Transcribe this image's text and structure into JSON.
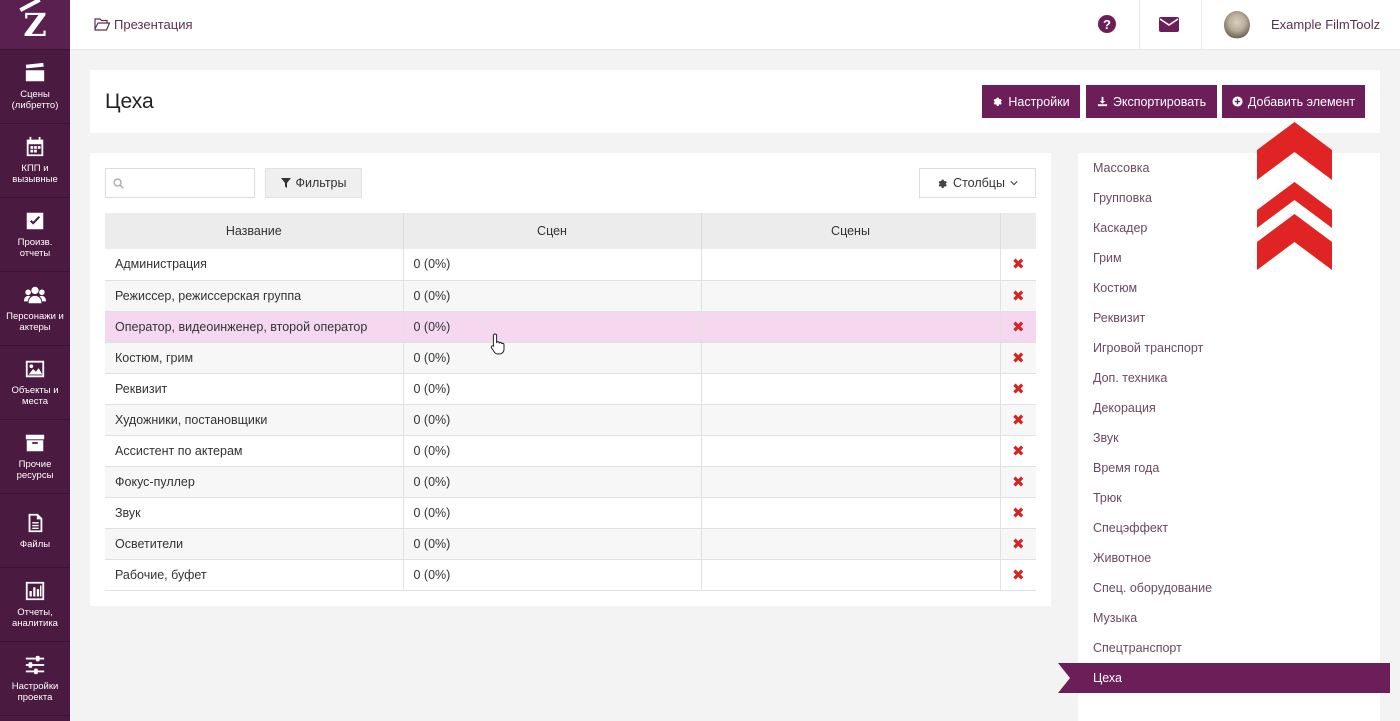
{
  "sidebar": {
    "logo": "Z",
    "items": [
      {
        "label": "Сцены\n(либретто)",
        "icon": "clapperboard-icon"
      },
      {
        "label": "КПП и\nвызывные",
        "icon": "calendar-icon"
      },
      {
        "label": "Произв.\nотчеты",
        "icon": "checkbox-icon"
      },
      {
        "label": "Персонажи и\nактеры",
        "icon": "users-icon"
      },
      {
        "label": "Объекты и\nместа",
        "icon": "image-icon"
      },
      {
        "label": "Прочие\nресурсы",
        "icon": "archive-icon"
      },
      {
        "label": "Файлы",
        "icon": "file-icon"
      },
      {
        "label": "Отчеты,\nаналитика",
        "icon": "bar-chart-icon"
      },
      {
        "label": "Настройки\nпроекта",
        "icon": "sliders-icon"
      }
    ]
  },
  "topbar": {
    "breadcrumb": "Презентация",
    "help": "?",
    "user_name": "Example FilmToolz"
  },
  "header": {
    "title": "Цеха",
    "settings_label": "Настройки",
    "export_label": "Экспортировать",
    "add_label": "Добавить элемент"
  },
  "toolbar": {
    "search_placeholder": "",
    "filter_label": "Фильтры",
    "columns_label": "Столбцы"
  },
  "table": {
    "columns": [
      "Название",
      "Сцен",
      "Сцены"
    ],
    "rows": [
      {
        "name": "Администрация",
        "count": "0 (0%)",
        "scenes": ""
      },
      {
        "name": "Режиссер, режиссерская группа",
        "count": "0 (0%)",
        "scenes": ""
      },
      {
        "name": "Оператор, видеоинженер, второй оператор",
        "count": "0 (0%)",
        "scenes": ""
      },
      {
        "name": "Костюм, грим",
        "count": "0 (0%)",
        "scenes": ""
      },
      {
        "name": "Реквизит",
        "count": "0 (0%)",
        "scenes": ""
      },
      {
        "name": "Художники, постановщики",
        "count": "0 (0%)",
        "scenes": ""
      },
      {
        "name": "Ассистент по актерам",
        "count": "0 (0%)",
        "scenes": ""
      },
      {
        "name": "Фокус-пуллер",
        "count": "0 (0%)",
        "scenes": ""
      },
      {
        "name": "Звук",
        "count": "0 (0%)",
        "scenes": ""
      },
      {
        "name": "Осветители",
        "count": "0 (0%)",
        "scenes": ""
      },
      {
        "name": "Рабочие, буфет",
        "count": "0 (0%)",
        "scenes": ""
      }
    ],
    "delete_glyph": "✖"
  },
  "categories": {
    "items": [
      "Массовка",
      "Групповка",
      "Каскадер",
      "Грим",
      "Костюм",
      "Реквизит",
      "Игровой транспорт",
      "Доп. техника",
      "Декорация",
      "Звук",
      "Время года",
      "Трюк",
      "Спецэффект",
      "Животное",
      "Спец. оборудование",
      "Музыка",
      "Спецтранспорт"
    ],
    "active": "Цеха"
  },
  "colors": {
    "brand": "#6b1e58",
    "sidebar": "#4b1a40",
    "highlight_row": "#f5d8ef",
    "delete": "#d42525",
    "annotation_arrow": "#e02424"
  }
}
